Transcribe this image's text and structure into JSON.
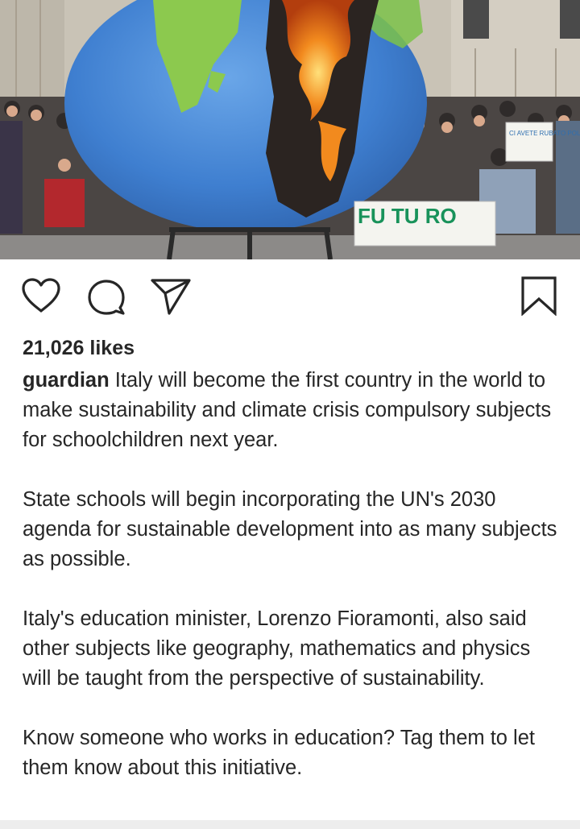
{
  "post": {
    "photo_alt": "photo",
    "protest_signs": [
      "FU TU RO",
      "CI AVETE RUBATO POLMONI"
    ],
    "likes_text": "21,026 likes",
    "username": "guardian",
    "caption_first": "Italy will become the first country in the world to make sustainability and climate crisis compulsory subjects for schoolchildren next year.",
    "caption_paragraphs": [
      "State schools will begin incorporating the UN's 2030 agenda for sustainable development into as many subjects as possible.",
      "Italy's education minister, Lorenzo Fioramonti, also said other subjects like geography, mathematics and physics will be taught from the perspective of sustainability.",
      "Know someone who works in education? Tag them to let them know about this initiative."
    ]
  },
  "icons": {
    "like": "heart-icon",
    "comment": "comment-icon",
    "share": "share-icon",
    "save": "bookmark-icon"
  },
  "colors": {
    "text": "#262626",
    "globe_blue": "#3f7fd0",
    "globe_green": "#7cc24a",
    "fire": "#f28a1e"
  }
}
